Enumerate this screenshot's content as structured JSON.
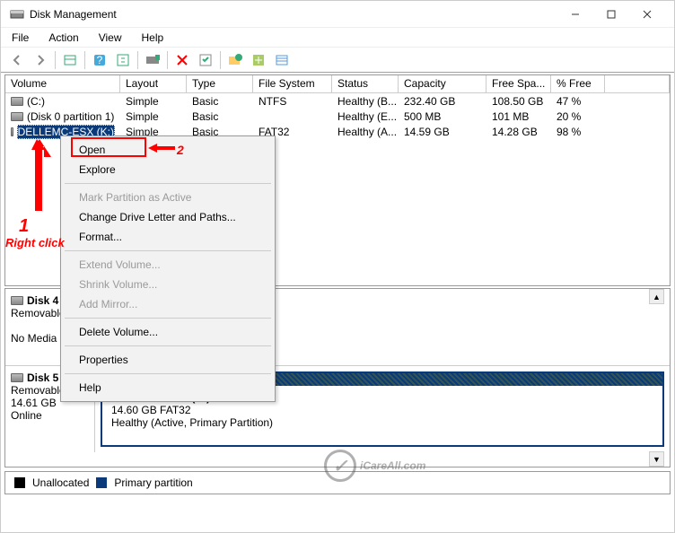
{
  "window": {
    "title": "Disk Management"
  },
  "menu": {
    "file": "File",
    "action": "Action",
    "view": "View",
    "help": "Help"
  },
  "columns": {
    "volume": "Volume",
    "layout": "Layout",
    "type": "Type",
    "fs": "File System",
    "status": "Status",
    "capacity": "Capacity",
    "free": "Free Spa...",
    "pfree": "% Free"
  },
  "rows": [
    {
      "vol": "(C:)",
      "layout": "Simple",
      "type": "Basic",
      "fs": "NTFS",
      "status": "Healthy (B...",
      "cap": "232.40 GB",
      "free": "108.50 GB",
      "pfree": "47 %"
    },
    {
      "vol": "(Disk 0 partition 1)",
      "layout": "Simple",
      "type": "Basic",
      "fs": "",
      "status": "Healthy (E...",
      "cap": "500 MB",
      "free": "101 MB",
      "pfree": "20 %"
    },
    {
      "vol": "DELLEMC-ESX (K:)",
      "layout": "Simple",
      "type": "Basic",
      "fs": "FAT32",
      "status": "Healthy (A...",
      "cap": "14.59 GB",
      "free": "14.28 GB",
      "pfree": "98 %"
    }
  ],
  "ctx": {
    "open": "Open",
    "explore": "Explore",
    "mark": "Mark Partition as Active",
    "change": "Change Drive Letter and Paths...",
    "format": "Format...",
    "extend": "Extend Volume...",
    "shrink": "Shrink Volume...",
    "mirror": "Add Mirror...",
    "delete": "Delete Volume...",
    "props": "Properties",
    "help": "Help"
  },
  "ann": {
    "num1": "1",
    "rc": "Right click",
    "num2": "2"
  },
  "disk4": {
    "name": "Disk 4",
    "type": "Removable",
    "nomedia": "No Media"
  },
  "disk5": {
    "name": "Disk 5",
    "type": "Removable",
    "size": "14.61 GB",
    "state": "Online",
    "vol": "DELLEMC-ESX  (K:)",
    "vol2": "14.60 GB FAT32",
    "vol3": "Healthy (Active, Primary Partition)"
  },
  "legend": {
    "unalloc": "Unallocated",
    "primary": "Primary partition"
  },
  "watermark": "iCareAll.com"
}
